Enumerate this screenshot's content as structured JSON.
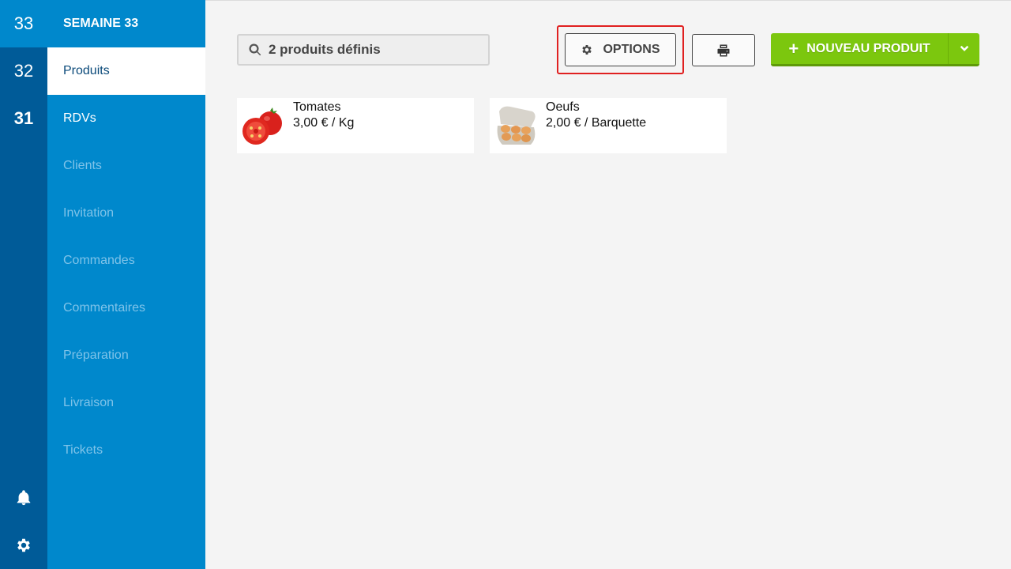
{
  "weeks": [
    {
      "label": "33"
    },
    {
      "label": "32"
    },
    {
      "label": "31"
    }
  ],
  "menu": {
    "title": "SEMAINE 33",
    "items": [
      {
        "label": "Produits"
      },
      {
        "label": "RDVs"
      },
      {
        "label": "Clients"
      },
      {
        "label": "Invitation"
      },
      {
        "label": "Commandes"
      },
      {
        "label": "Commentaires"
      },
      {
        "label": "Préparation"
      },
      {
        "label": "Livraison"
      },
      {
        "label": "Tickets"
      }
    ]
  },
  "toolbar": {
    "search_placeholder": "2 produits définis",
    "options_label": "OPTIONS",
    "new_product_label": "NOUVEAU PRODUIT"
  },
  "products": [
    {
      "name": "Tomates",
      "price": "3,00 € / Kg",
      "icon": "tomato-image"
    },
    {
      "name": "Oeufs",
      "price": "2,00 € / Barquette",
      "icon": "eggs-image"
    }
  ],
  "colors": {
    "rail": "#005b98",
    "menu": "#0088cc",
    "accent_green": "#7cc70e",
    "highlight": "#e02020"
  }
}
